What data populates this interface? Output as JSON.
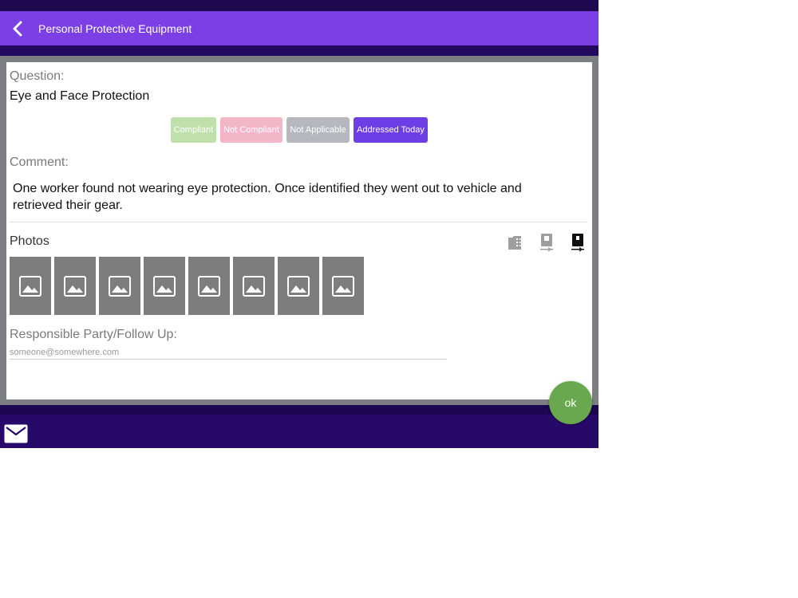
{
  "header": {
    "title": "Personal Protective Equipment",
    "back_icon": "chevron-left-icon"
  },
  "question": {
    "label": "Question:",
    "text": "Eye and Face Protection"
  },
  "status_options": [
    {
      "label": "Compliant",
      "color": "#bfe0aa"
    },
    {
      "label": "Not Compliant",
      "color": "#f2b6c6"
    },
    {
      "label": "Not Applicable",
      "color": "#b7b8bf"
    },
    {
      "label": "Addressed Today",
      "color": "#6d3ee6",
      "selected": true
    }
  ],
  "comment": {
    "label": "Comment:",
    "text": "One worker found not wearing eye protection. Once identified they went out to vehicle and retrieved their gear."
  },
  "photos": {
    "label": "Photos",
    "thumbnail_count": 8,
    "tools": [
      "photo-library-icon",
      "upload-photo-icon",
      "download-photo-icon"
    ]
  },
  "responsible": {
    "label": "Responsible Party/Follow Up:",
    "placeholder": "someone@somewhere.com",
    "value": ""
  },
  "actions": {
    "ok_label": "ok",
    "mail_icon": "mail-icon"
  },
  "colors": {
    "nav": "#7c3fe6",
    "chrome": "#2a0d6e",
    "ok": "#6aa84f"
  }
}
